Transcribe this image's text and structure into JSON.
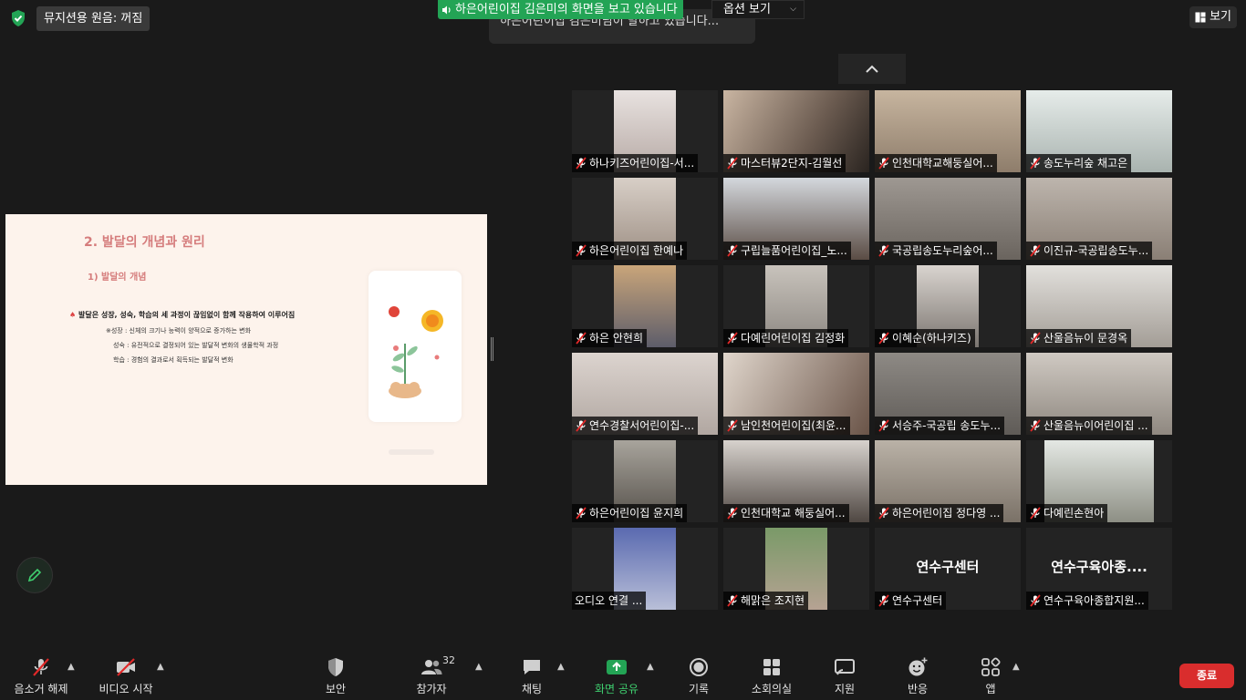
{
  "top": {
    "original_sound": "뮤지션용 원음: 꺼짐",
    "share_banner": "하은어린이집 김은미의 화면을 보고 있습니다",
    "options_label": "옵션 보기",
    "toast": "하은어린이집 김은미님이 말하고 있습니다...",
    "view_label": "보기",
    "accent_green": "#23a455"
  },
  "slide": {
    "title": "2. 발달의 개념과 원리",
    "subtitle": "1) 발달의 개념",
    "bullet": "발달은 성장, 성숙, 학습의 세 과정이 끊임없이 함께 작용하여 이루어짐",
    "growth": "※성장 : 신체의 크기나 능력이 양적으로 증가하는 변화",
    "maturation": "성숙 : 유전적으로 결정되어 있는 발달적 변화의 생물학적 과정",
    "learning": "학습 : 경험의 결과로서 획득되는 발달적 변화"
  },
  "participants": [
    {
      "name": "하나키즈어린이집-서..."
    },
    {
      "name": "마스터뷰2단지-김월선"
    },
    {
      "name": "인천대학교해둥실어..."
    },
    {
      "name": "송도누리숲 채고은"
    },
    {
      "name": "하은어린이집 한예나"
    },
    {
      "name": "구립늘품어린이집_노..."
    },
    {
      "name": "국공립송도누리숲어..."
    },
    {
      "name": "이진규-국공립송도누..."
    },
    {
      "name": "하은 안현희"
    },
    {
      "name": "다예린어린이집 김정화"
    },
    {
      "name": "이혜순(하나키즈)"
    },
    {
      "name": "산울음뉴이 문경옥"
    },
    {
      "name": "연수경찰서어린이집-..."
    },
    {
      "name": "남인천어린이집(최윤..."
    },
    {
      "name": "서승주-국공립 송도누..."
    },
    {
      "name": "산울음뉴이어린이집 ..."
    },
    {
      "name": "하은어린이집 윤지희"
    },
    {
      "name": "인천대학교 해둥실어..."
    },
    {
      "name": "하은어린이집 정다영 ..."
    },
    {
      "name": "다예린손현아"
    },
    {
      "name": "오디오 연결 ..."
    },
    {
      "name": "해맑은 조지현"
    },
    {
      "name": "연수구센터",
      "big": "연수구센터"
    },
    {
      "name": "연수구육아종합지원...",
      "big": "연수구육아종...."
    }
  ],
  "toolbar": {
    "unmute": "음소거 해제",
    "start_video": "비디오 시작",
    "security": "보안",
    "participants": "참가자",
    "participant_count": "32",
    "chat": "채팅",
    "share_screen": "화면 공유",
    "record": "기록",
    "breakout": "소회의실",
    "support": "지원",
    "reactions": "반응",
    "apps": "앱",
    "end": "종료",
    "end_color": "#d92d2d"
  }
}
